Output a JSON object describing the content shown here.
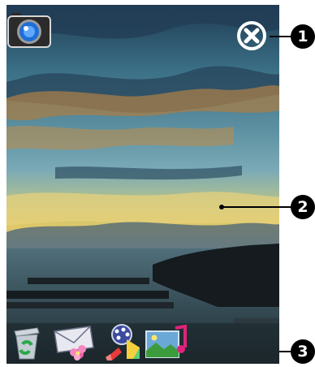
{
  "callouts": [
    {
      "number": "1",
      "target": "close-button"
    },
    {
      "number": "2",
      "target": "photo-view"
    },
    {
      "number": "3",
      "target": "bottom-toolbar"
    }
  ],
  "toolbar": {
    "buttons": [
      "recycle-icon",
      "send-mail-icon",
      "effects-icon",
      "gallery-music-icon"
    ]
  },
  "top_controls": [
    "camera-icon",
    "close-icon"
  ]
}
